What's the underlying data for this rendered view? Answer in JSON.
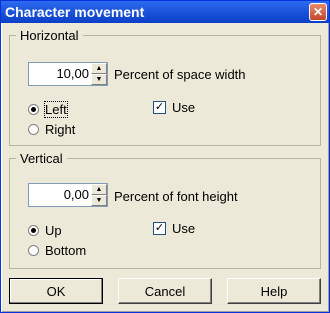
{
  "window": {
    "title": "Character movement",
    "close_glyph": "✕"
  },
  "horizontal": {
    "legend": "Horizontal",
    "value": "10,00",
    "label": "Percent of space width",
    "radio_options": [
      "Left",
      "Right"
    ],
    "selected": "Left",
    "use_label": "Use",
    "use_checked": true
  },
  "vertical": {
    "legend": "Vertical",
    "value": "0,00",
    "label": "Percent of font height",
    "radio_options": [
      "Up",
      "Bottom"
    ],
    "selected": "Up",
    "use_label": "Use",
    "use_checked": true
  },
  "buttons": {
    "ok": "OK",
    "cancel": "Cancel",
    "help": "Help"
  },
  "glyphs": {
    "spin_up": "▲",
    "spin_down": "▼",
    "check": "✓"
  }
}
